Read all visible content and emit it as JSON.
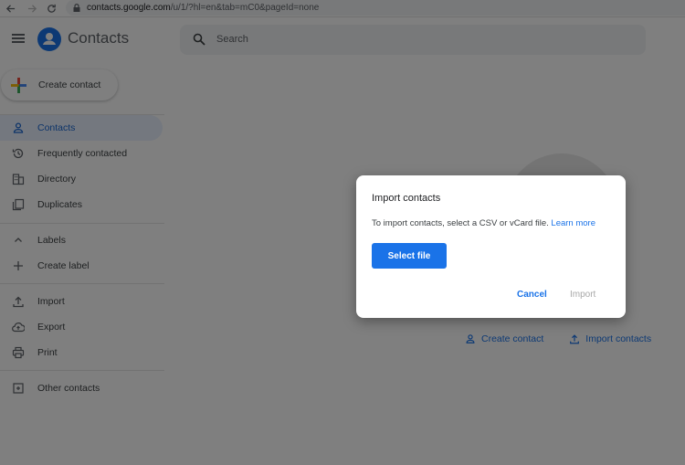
{
  "browser": {
    "url_host": "contacts.google.com",
    "url_path": "/u/1/?hl=en&tab=mC0&pageId=none"
  },
  "header": {
    "app_title": "Contacts",
    "search_placeholder": "Search"
  },
  "create_contact_label": "Create contact",
  "sidebar": {
    "items": [
      {
        "label": "Contacts",
        "icon": "person-icon",
        "active": true
      },
      {
        "label": "Frequently contacted",
        "icon": "history-icon"
      },
      {
        "label": "Directory",
        "icon": "building-icon"
      },
      {
        "label": "Duplicates",
        "icon": "copy-icon"
      }
    ],
    "labels_section": [
      {
        "label": "Labels",
        "icon": "chevron-up-icon"
      },
      {
        "label": "Create label",
        "icon": "plus-icon"
      }
    ],
    "tools": [
      {
        "label": "Import",
        "icon": "upload-icon"
      },
      {
        "label": "Export",
        "icon": "cloud-upload-icon"
      },
      {
        "label": "Print",
        "icon": "printer-icon"
      }
    ],
    "other": [
      {
        "label": "Other contacts",
        "icon": "archive-icon"
      }
    ]
  },
  "empty_state": {
    "create_contact": "Create contact",
    "import_contacts": "Import contacts"
  },
  "dialog": {
    "title": "Import contacts",
    "body": "To import contacts, select a CSV or vCard file.",
    "learn_more": "Learn more",
    "select_file": "Select file",
    "cancel": "Cancel",
    "import": "Import"
  },
  "colors": {
    "accent": "#1a73e8",
    "scrim": "rgba(0,0,0,0.5)"
  }
}
